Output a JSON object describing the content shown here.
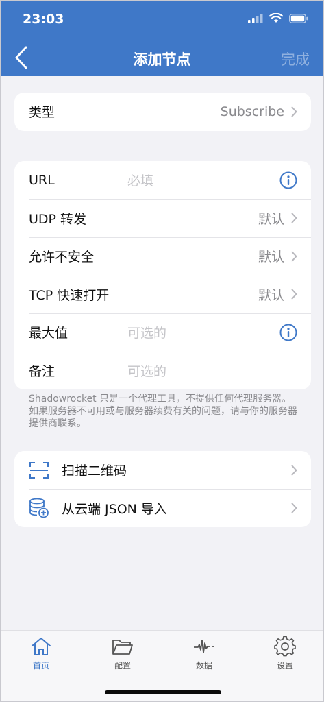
{
  "status_bar": {
    "time": "23:03"
  },
  "nav": {
    "title": "添加节点",
    "done_label": "完成"
  },
  "type_row": {
    "label": "类型",
    "value": "Subscribe"
  },
  "form": {
    "url": {
      "label": "URL",
      "placeholder": "必填"
    },
    "udp": {
      "label": "UDP 转发",
      "value": "默认"
    },
    "insecure": {
      "label": "允许不安全",
      "value": "默认"
    },
    "tfo": {
      "label": "TCP 快速打开",
      "value": "默认"
    },
    "max": {
      "label": "最大值",
      "placeholder": "可选的"
    },
    "remark": {
      "label": "备注",
      "placeholder": "可选的"
    }
  },
  "note": "Shadowrocket 只是一个代理工具，不提供任何代理服务器。如果服务器不可用或与服务器续费有关的问题，请与你的服务器提供商联系。",
  "actions": {
    "scan": {
      "label": "扫描二维码",
      "icon": "qr-scan-icon"
    },
    "import": {
      "label": "从云端 JSON 导入",
      "icon": "database-add-icon"
    }
  },
  "tabs": [
    {
      "label": "首页",
      "icon": "home-icon",
      "active": true
    },
    {
      "label": "配置",
      "icon": "folder-icon",
      "active": false
    },
    {
      "label": "数据",
      "icon": "waveform-icon",
      "active": false
    },
    {
      "label": "设置",
      "icon": "gear-icon",
      "active": false
    }
  ],
  "colors": {
    "accent": "#3f78c8",
    "background": "#f2f2f6",
    "placeholder": "#c4c4c8"
  }
}
